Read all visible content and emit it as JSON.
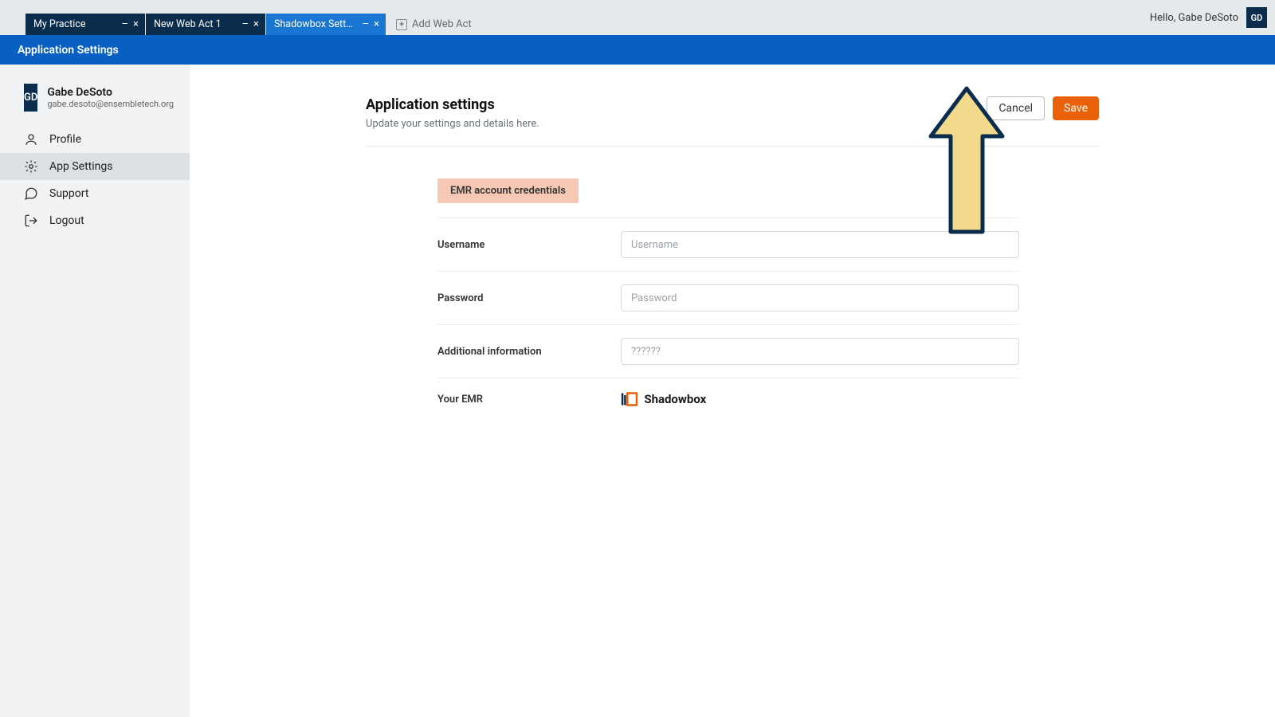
{
  "tabs": [
    {
      "title": "My Practice"
    },
    {
      "title": "New Web Act 1"
    },
    {
      "title": "Shadowbox Settings"
    }
  ],
  "add_tab_label": "Add Web Act",
  "greeting": "Hello, Gabe DeSoto",
  "user_initials": "GD",
  "banner_title": "Application Settings",
  "user": {
    "name": "Gabe DeSoto",
    "email": "gabe.desoto@ensembletech.org",
    "initials": "GD"
  },
  "nav": {
    "profile": "Profile",
    "app_settings": "App Settings",
    "support": "Support",
    "logout": "Logout"
  },
  "page": {
    "title": "Application settings",
    "subtitle": "Update your settings and details here.",
    "cancel": "Cancel",
    "save": "Save"
  },
  "form": {
    "section_label": "EMR account credentials",
    "username_label": "Username",
    "username_placeholder": "Username",
    "username_value": "",
    "password_label": "Password",
    "password_placeholder": "Password",
    "password_value": "",
    "additional_label": "Additional information",
    "additional_placeholder": "??????",
    "additional_value": "",
    "emr_label": "Your EMR",
    "emr_name": "Shadowbox"
  }
}
